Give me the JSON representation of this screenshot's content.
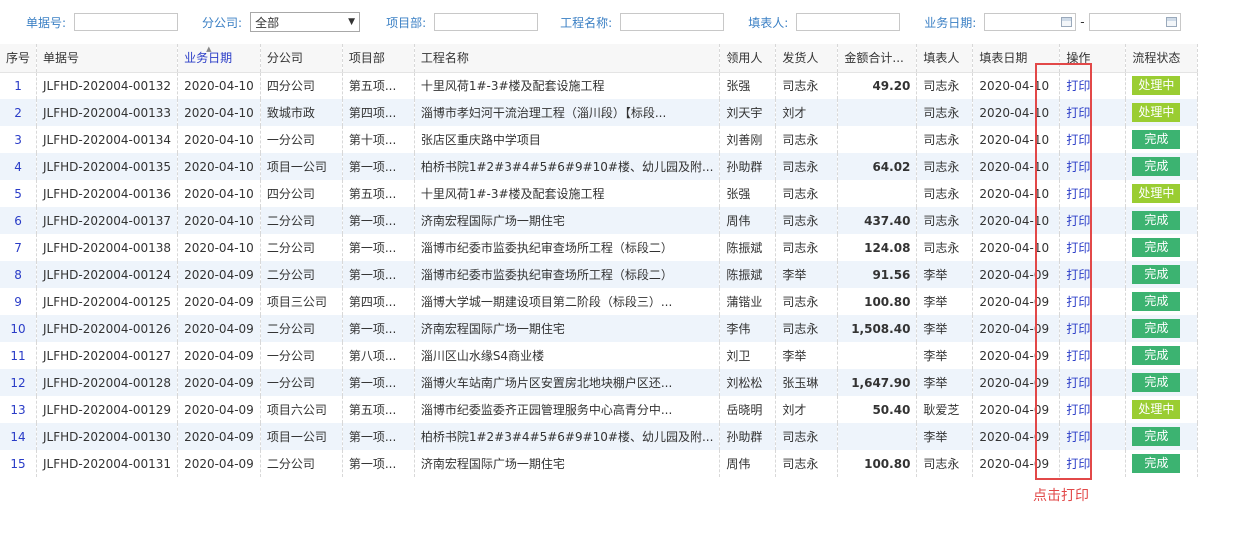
{
  "filters": {
    "doc_no_label": "单据号:",
    "branch_label": "分公司:",
    "branch_value": "全部",
    "project_dept_label": "项目部:",
    "project_name_label": "工程名称:",
    "filler_label": "填表人:",
    "biz_date_label": "业务日期:",
    "date_separator": "-"
  },
  "columns": [
    "序号",
    "单据号",
    "业务日期",
    "分公司",
    "项目部",
    "工程名称",
    "领用人",
    "发货人",
    "金额合计...",
    "填表人",
    "填表日期",
    "操作",
    "流程状态"
  ],
  "rows": [
    {
      "idx": "1",
      "doc": "JLFHD-202004-00132",
      "date": "2020-04-10",
      "branch": "四分公司",
      "dept": "第五项...",
      "project": "十里风荷1#-3#楼及配套设施工程",
      "receiver": "张强",
      "shipper": "司志永",
      "amount": "49.20",
      "filler": "司志永",
      "fill_date": "2020-04-10",
      "op": "打印",
      "status": "处理中",
      "status_type": "proc"
    },
    {
      "idx": "2",
      "doc": "JLFHD-202004-00133",
      "date": "2020-04-10",
      "branch": "致城市政",
      "dept": "第四项...",
      "project": "淄博市孝妇河干流治理工程（淄川段）【标段...",
      "receiver": "刘天宇",
      "shipper": "刘才",
      "amount": "",
      "filler": "司志永",
      "fill_date": "2020-04-10",
      "op": "打印",
      "status": "处理中",
      "status_type": "proc"
    },
    {
      "idx": "3",
      "doc": "JLFHD-202004-00134",
      "date": "2020-04-10",
      "branch": "一分公司",
      "dept": "第十项...",
      "project": "张店区重庆路中学项目",
      "receiver": "刘善刚",
      "shipper": "司志永",
      "amount": "",
      "filler": "司志永",
      "fill_date": "2020-04-10",
      "op": "打印",
      "status": "完成",
      "status_type": "done"
    },
    {
      "idx": "4",
      "doc": "JLFHD-202004-00135",
      "date": "2020-04-10",
      "branch": "项目一公司",
      "dept": "第一项...",
      "project": "柏桥书院1#2#3#4#5#6#9#10#楼、幼儿园及附...",
      "receiver": "孙助群",
      "shipper": "司志永",
      "amount": "64.02",
      "filler": "司志永",
      "fill_date": "2020-04-10",
      "op": "打印",
      "status": "完成",
      "status_type": "done"
    },
    {
      "idx": "5",
      "doc": "JLFHD-202004-00136",
      "date": "2020-04-10",
      "branch": "四分公司",
      "dept": "第五项...",
      "project": "十里风荷1#-3#楼及配套设施工程",
      "receiver": "张强",
      "shipper": "司志永",
      "amount": "",
      "filler": "司志永",
      "fill_date": "2020-04-10",
      "op": "打印",
      "status": "处理中",
      "status_type": "proc"
    },
    {
      "idx": "6",
      "doc": "JLFHD-202004-00137",
      "date": "2020-04-10",
      "branch": "二分公司",
      "dept": "第一项...",
      "project": "济南宏程国际广场一期住宅",
      "receiver": "周伟",
      "shipper": "司志永",
      "amount": "437.40",
      "filler": "司志永",
      "fill_date": "2020-04-10",
      "op": "打印",
      "status": "完成",
      "status_type": "done"
    },
    {
      "idx": "7",
      "doc": "JLFHD-202004-00138",
      "date": "2020-04-10",
      "branch": "二分公司",
      "dept": "第一项...",
      "project": "淄博市纪委市监委执纪审查场所工程（标段二）",
      "receiver": "陈振斌",
      "shipper": "司志永",
      "amount": "124.08",
      "filler": "司志永",
      "fill_date": "2020-04-10",
      "op": "打印",
      "status": "完成",
      "status_type": "done"
    },
    {
      "idx": "8",
      "doc": "JLFHD-202004-00124",
      "date": "2020-04-09",
      "branch": "二分公司",
      "dept": "第一项...",
      "project": "淄博市纪委市监委执纪审查场所工程（标段二）",
      "receiver": "陈振斌",
      "shipper": "李举",
      "amount": "91.56",
      "filler": "李举",
      "fill_date": "2020-04-09",
      "op": "打印",
      "status": "完成",
      "status_type": "done"
    },
    {
      "idx": "9",
      "doc": "JLFHD-202004-00125",
      "date": "2020-04-09",
      "branch": "项目三公司",
      "dept": "第四项...",
      "project": "淄博大学城一期建设项目第二阶段（标段三）...",
      "receiver": "蒲锴业",
      "shipper": "司志永",
      "amount": "100.80",
      "filler": "李举",
      "fill_date": "2020-04-09",
      "op": "打印",
      "status": "完成",
      "status_type": "done"
    },
    {
      "idx": "10",
      "doc": "JLFHD-202004-00126",
      "date": "2020-04-09",
      "branch": "二分公司",
      "dept": "第一项...",
      "project": "济南宏程国际广场一期住宅",
      "receiver": "李伟",
      "shipper": "司志永",
      "amount": "1,508.40",
      "filler": "李举",
      "fill_date": "2020-04-09",
      "op": "打印",
      "status": "完成",
      "status_type": "done"
    },
    {
      "idx": "11",
      "doc": "JLFHD-202004-00127",
      "date": "2020-04-09",
      "branch": "一分公司",
      "dept": "第八项...",
      "project": "淄川区山水缘S4商业楼",
      "receiver": "刘卫",
      "shipper": "李举",
      "amount": "",
      "filler": "李举",
      "fill_date": "2020-04-09",
      "op": "打印",
      "status": "完成",
      "status_type": "done"
    },
    {
      "idx": "12",
      "doc": "JLFHD-202004-00128",
      "date": "2020-04-09",
      "branch": "一分公司",
      "dept": "第一项...",
      "project": "淄博火车站南广场片区安置房北地块棚户区还...",
      "receiver": "刘松松",
      "shipper": "张玉琳",
      "amount": "1,647.90",
      "filler": "李举",
      "fill_date": "2020-04-09",
      "op": "打印",
      "status": "完成",
      "status_type": "done"
    },
    {
      "idx": "13",
      "doc": "JLFHD-202004-00129",
      "date": "2020-04-09",
      "branch": "项目六公司",
      "dept": "第五项...",
      "project": "淄博市纪委监委齐正园管理服务中心高青分中...",
      "receiver": "岳晓明",
      "shipper": "刘才",
      "amount": "50.40",
      "filler": "耿爱芝",
      "fill_date": "2020-04-09",
      "op": "打印",
      "status": "处理中",
      "status_type": "proc"
    },
    {
      "idx": "14",
      "doc": "JLFHD-202004-00130",
      "date": "2020-04-09",
      "branch": "项目一公司",
      "dept": "第一项...",
      "project": "柏桥书院1#2#3#4#5#6#9#10#楼、幼儿园及附...",
      "receiver": "孙助群",
      "shipper": "司志永",
      "amount": "",
      "filler": "李举",
      "fill_date": "2020-04-09",
      "op": "打印",
      "status": "完成",
      "status_type": "done"
    },
    {
      "idx": "15",
      "doc": "JLFHD-202004-00131",
      "date": "2020-04-09",
      "branch": "二分公司",
      "dept": "第一项...",
      "project": "济南宏程国际广场一期住宅",
      "receiver": "周伟",
      "shipper": "司志永",
      "amount": "100.80",
      "filler": "司志永",
      "fill_date": "2020-04-09",
      "op": "打印",
      "status": "完成",
      "status_type": "done"
    }
  ],
  "annotation": "点击打印",
  "colors": {
    "accent": "#2a3cc7",
    "label": "#3a7fc4",
    "done": "#3cb371",
    "processing": "#9acd32",
    "highlight": "#e24848"
  }
}
